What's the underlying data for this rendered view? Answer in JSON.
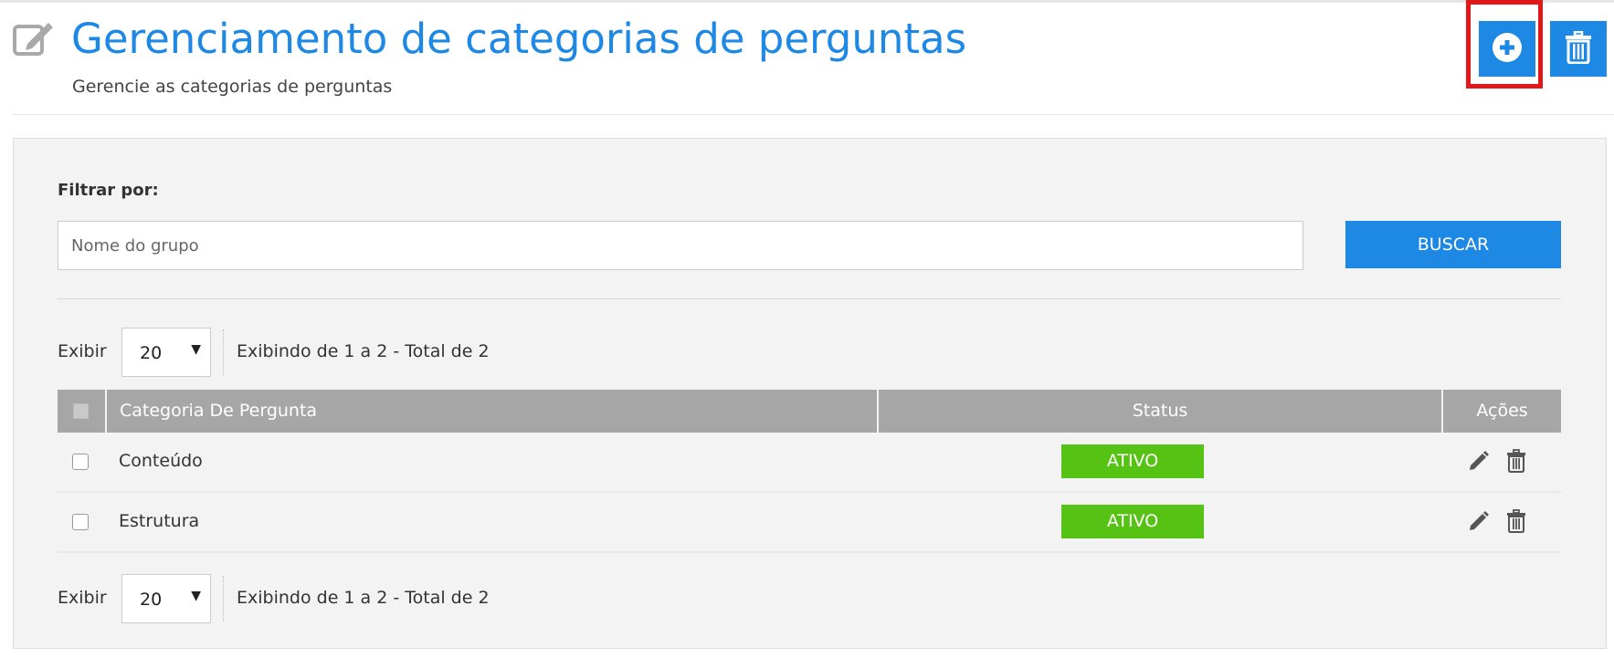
{
  "header": {
    "title": "Gerenciamento de categorias de perguntas",
    "subtitle": "Gerencie as categorias de perguntas",
    "page_icon": "edit-square-icon",
    "add_icon": "plus-circle-icon",
    "delete_icon": "trash-icon"
  },
  "filter": {
    "label": "Filtrar por:",
    "placeholder": "Nome do grupo",
    "value": "",
    "button": "BUSCAR"
  },
  "pagination": {
    "label": "Exibir",
    "per_page": "20",
    "info": "Exibindo de 1 a 2 - Total de 2"
  },
  "table": {
    "columns": [
      "Categoria De Pergunta",
      "Status",
      "Ações"
    ],
    "rows": [
      {
        "name": "Conteúdo",
        "status": "ATIVO"
      },
      {
        "name": "Estrutura",
        "status": "ATIVO"
      }
    ]
  },
  "colors": {
    "primary": "#1e88e5",
    "active_badge": "#56c314",
    "highlight": "#e21818",
    "table_header": "#a6a6a6"
  }
}
